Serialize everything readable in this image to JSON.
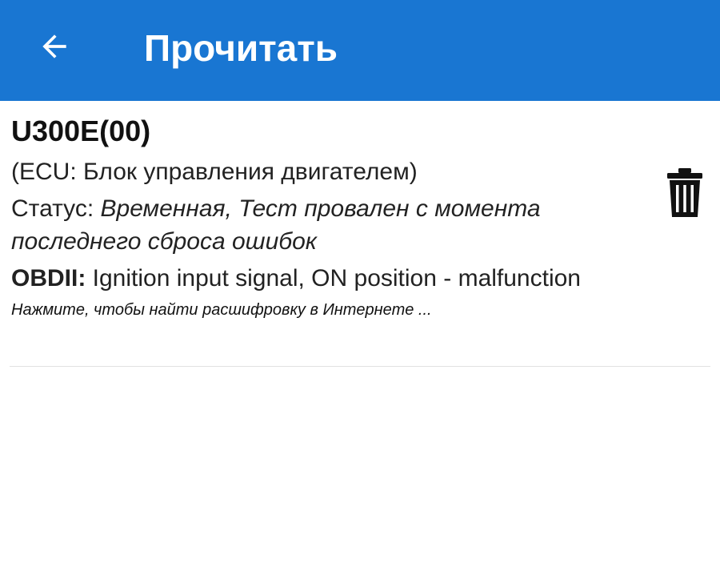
{
  "appbar": {
    "title": "Прочитать",
    "back_icon": "arrow-left-icon",
    "color": "#1976d2"
  },
  "dtc": {
    "code": "U300E(00)",
    "ecu": "(ECU: Блок управления двигателем)",
    "status_label": "Статус: ",
    "status_value": "Временная, Тест провален с момента последнего сброса ошибок",
    "obdii_label": "OBDII:",
    "obdii_value": " Ignition input signal, ON position - malfunction",
    "hint": "Нажмите, чтобы найти расшифровку в Интернете ...",
    "delete_icon": "trash-icon"
  }
}
